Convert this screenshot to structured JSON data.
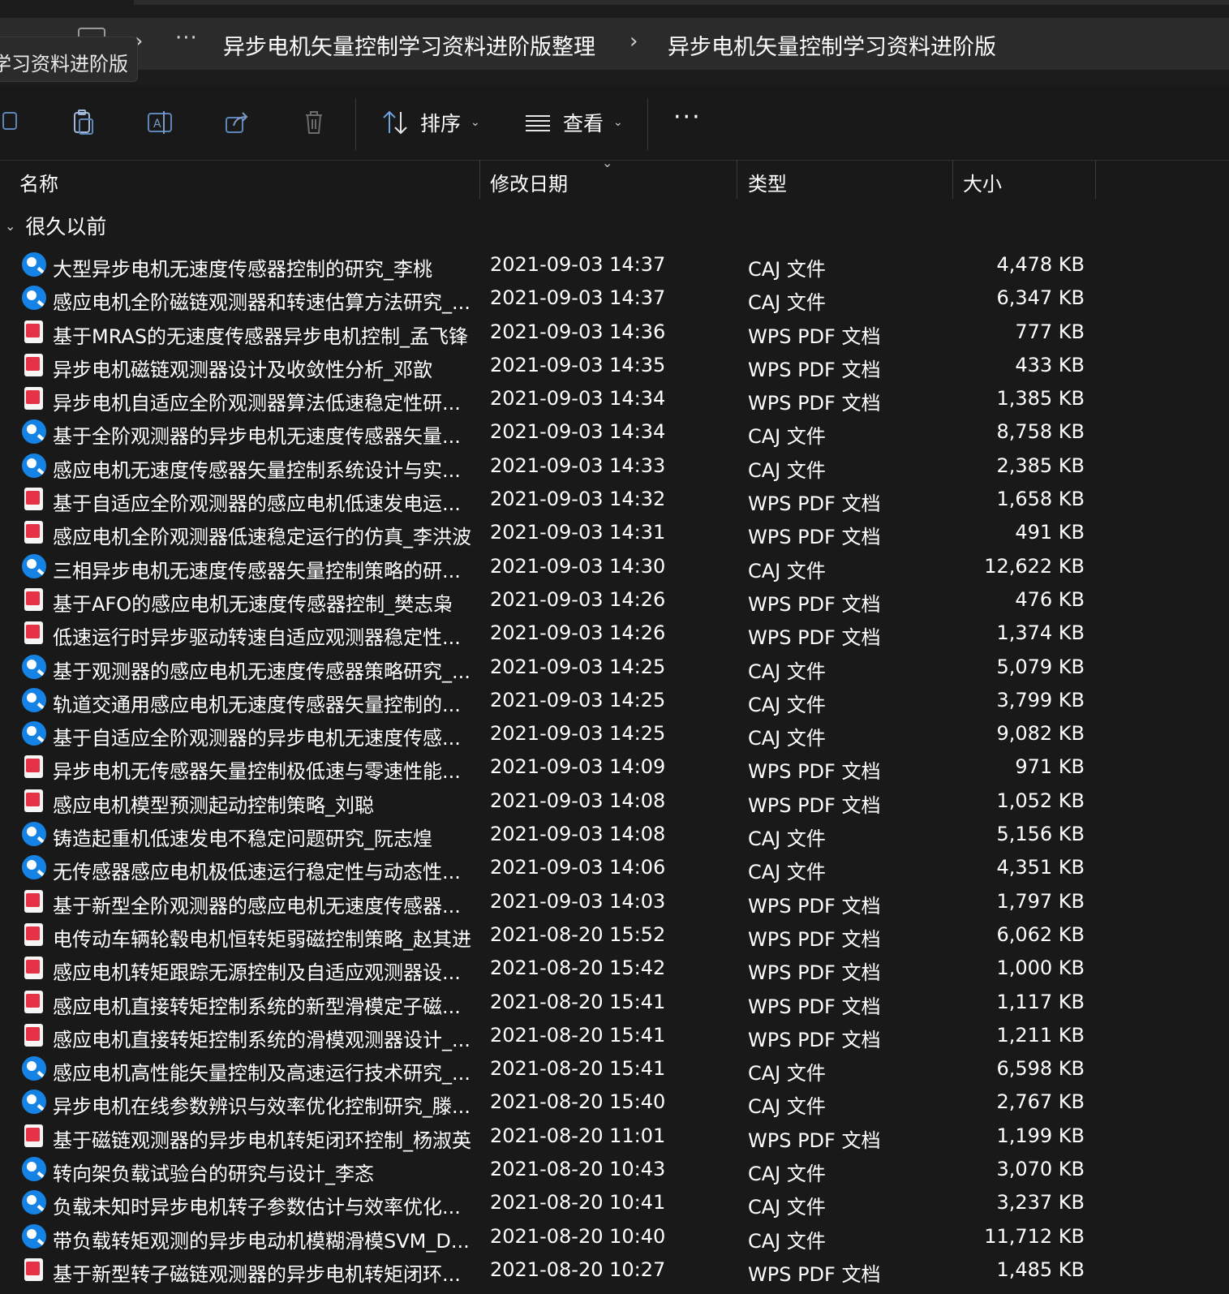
{
  "window": {
    "tab_title_fragment": "学习资料进阶版",
    "breadcrumb": {
      "more": "···",
      "items": [
        "异步电机矢量控制学习资料进阶版整理",
        "异步电机矢量控制学习资料进阶版"
      ],
      "separator": "›"
    }
  },
  "toolbar": {
    "sort_label": "排序",
    "view_label": "查看",
    "more_label": "···",
    "icons": [
      "copy-icon",
      "paste-icon",
      "rename-icon",
      "share-icon",
      "delete-icon",
      "sort-icon",
      "view-icon"
    ]
  },
  "columns": {
    "name": "名称",
    "modified": "修改日期",
    "type": "类型",
    "size": "大小"
  },
  "group": {
    "label": "很久以前"
  },
  "colors": {
    "caj_icon": "#1583e6",
    "pdf_icon": "#e63246",
    "background": "#191919"
  },
  "files": [
    {
      "icon": "caj",
      "name": "大型异步电机无速度传感器控制的研究_李桃",
      "date": "2021-09-03 14:37",
      "type": "CAJ 文件",
      "size": "4,478 KB"
    },
    {
      "icon": "caj",
      "name": "感应电机全阶磁链观测器和转速估算方法研究_...",
      "date": "2021-09-03 14:37",
      "type": "CAJ 文件",
      "size": "6,347 KB"
    },
    {
      "icon": "pdf",
      "name": "基于MRAS的无速度传感器异步电机控制_孟飞锋",
      "date": "2021-09-03 14:36",
      "type": "WPS PDF 文档",
      "size": "777 KB"
    },
    {
      "icon": "pdf",
      "name": "异步电机磁链观测器设计及收敛性分析_邓歆",
      "date": "2021-09-03 14:35",
      "type": "WPS PDF 文档",
      "size": "433 KB"
    },
    {
      "icon": "pdf",
      "name": "异步电机自适应全阶观测器算法低速稳定性研...",
      "date": "2021-09-03 14:34",
      "type": "WPS PDF 文档",
      "size": "1,385 KB"
    },
    {
      "icon": "caj",
      "name": "基于全阶观测器的异步电机无速度传感器矢量...",
      "date": "2021-09-03 14:34",
      "type": "CAJ 文件",
      "size": "8,758 KB"
    },
    {
      "icon": "caj",
      "name": "感应电机无速度传感器矢量控制系统设计与实...",
      "date": "2021-09-03 14:33",
      "type": "CAJ 文件",
      "size": "2,385 KB"
    },
    {
      "icon": "pdf",
      "name": "基于自适应全阶观测器的感应电机低速发电运...",
      "date": "2021-09-03 14:32",
      "type": "WPS PDF 文档",
      "size": "1,658 KB"
    },
    {
      "icon": "pdf",
      "name": "感应电机全阶观测器低速稳定运行的仿真_李洪波",
      "date": "2021-09-03 14:31",
      "type": "WPS PDF 文档",
      "size": "491 KB"
    },
    {
      "icon": "caj",
      "name": "三相异步电机无速度传感器矢量控制策略的研...",
      "date": "2021-09-03 14:30",
      "type": "CAJ 文件",
      "size": "12,622 KB"
    },
    {
      "icon": "pdf",
      "name": "基于AFO的感应电机无速度传感器控制_樊志枭",
      "date": "2021-09-03 14:26",
      "type": "WPS PDF 文档",
      "size": "476 KB"
    },
    {
      "icon": "pdf",
      "name": "低速运行时异步驱动转速自适应观测器稳定性...",
      "date": "2021-09-03 14:26",
      "type": "WPS PDF 文档",
      "size": "1,374 KB"
    },
    {
      "icon": "caj",
      "name": "基于观测器的感应电机无速度传感器策略研究_...",
      "date": "2021-09-03 14:25",
      "type": "CAJ 文件",
      "size": "5,079 KB"
    },
    {
      "icon": "caj",
      "name": "轨道交通用感应电机无速度传感器矢量控制的...",
      "date": "2021-09-03 14:25",
      "type": "CAJ 文件",
      "size": "3,799 KB"
    },
    {
      "icon": "caj",
      "name": "基于自适应全阶观测器的异步电机无速度传感...",
      "date": "2021-09-03 14:25",
      "type": "CAJ 文件",
      "size": "9,082 KB"
    },
    {
      "icon": "pdf",
      "name": "异步电机无传感器矢量控制极低速与零速性能...",
      "date": "2021-09-03 14:09",
      "type": "WPS PDF 文档",
      "size": "971 KB"
    },
    {
      "icon": "pdf",
      "name": "感应电机模型预测起动控制策略_刘聪",
      "date": "2021-09-03 14:08",
      "type": "WPS PDF 文档",
      "size": "1,052 KB"
    },
    {
      "icon": "caj",
      "name": "铸造起重机低速发电不稳定问题研究_阮志煌",
      "date": "2021-09-03 14:08",
      "type": "CAJ 文件",
      "size": "5,156 KB"
    },
    {
      "icon": "caj",
      "name": "无传感器感应电机极低速运行稳定性与动态性...",
      "date": "2021-09-03 14:06",
      "type": "CAJ 文件",
      "size": "4,351 KB"
    },
    {
      "icon": "pdf",
      "name": "基于新型全阶观测器的感应电机无速度传感器...",
      "date": "2021-09-03 14:03",
      "type": "WPS PDF 文档",
      "size": "1,797 KB"
    },
    {
      "icon": "pdf",
      "name": "电传动车辆轮毂电机恒转矩弱磁控制策略_赵其进",
      "date": "2021-08-20 15:52",
      "type": "WPS PDF 文档",
      "size": "6,062 KB"
    },
    {
      "icon": "pdf",
      "name": "感应电机转矩跟踪无源控制及自适应观测器设...",
      "date": "2021-08-20 15:42",
      "type": "WPS PDF 文档",
      "size": "1,000 KB"
    },
    {
      "icon": "pdf",
      "name": "感应电机直接转矩控制系统的新型滑模定子磁...",
      "date": "2021-08-20 15:41",
      "type": "WPS PDF 文档",
      "size": "1,117 KB"
    },
    {
      "icon": "pdf",
      "name": "感应电机直接转矩控制系统的滑模观测器设计_...",
      "date": "2021-08-20 15:41",
      "type": "WPS PDF 文档",
      "size": "1,211 KB"
    },
    {
      "icon": "caj",
      "name": "感应电机高性能矢量控制及高速运行技术研究_...",
      "date": "2021-08-20 15:41",
      "type": "CAJ 文件",
      "size": "6,598 KB"
    },
    {
      "icon": "caj",
      "name": "异步电机在线参数辨识与效率优化控制研究_滕...",
      "date": "2021-08-20 15:40",
      "type": "CAJ 文件",
      "size": "2,767 KB"
    },
    {
      "icon": "pdf",
      "name": "基于磁链观测器的异步电机转矩闭环控制_杨淑英",
      "date": "2021-08-20 11:01",
      "type": "WPS PDF 文档",
      "size": "1,199 KB"
    },
    {
      "icon": "caj",
      "name": "转向架负载试验台的研究与设计_李忞",
      "date": "2021-08-20 10:43",
      "type": "CAJ 文件",
      "size": "3,070 KB"
    },
    {
      "icon": "caj",
      "name": "负载未知时异步电机转子参数估计与效率优化...",
      "date": "2021-08-20 10:41",
      "type": "CAJ 文件",
      "size": "3,237 KB"
    },
    {
      "icon": "caj",
      "name": "带负载转矩观测的异步电动机模糊滑模SVM_D...",
      "date": "2021-08-20 10:40",
      "type": "CAJ 文件",
      "size": "11,712 KB"
    },
    {
      "icon": "pdf",
      "name": "基于新型转子磁链观测器的异步电机转矩闭环...",
      "date": "2021-08-20 10:27",
      "type": "WPS PDF 文档",
      "size": "1,485 KB"
    }
  ]
}
